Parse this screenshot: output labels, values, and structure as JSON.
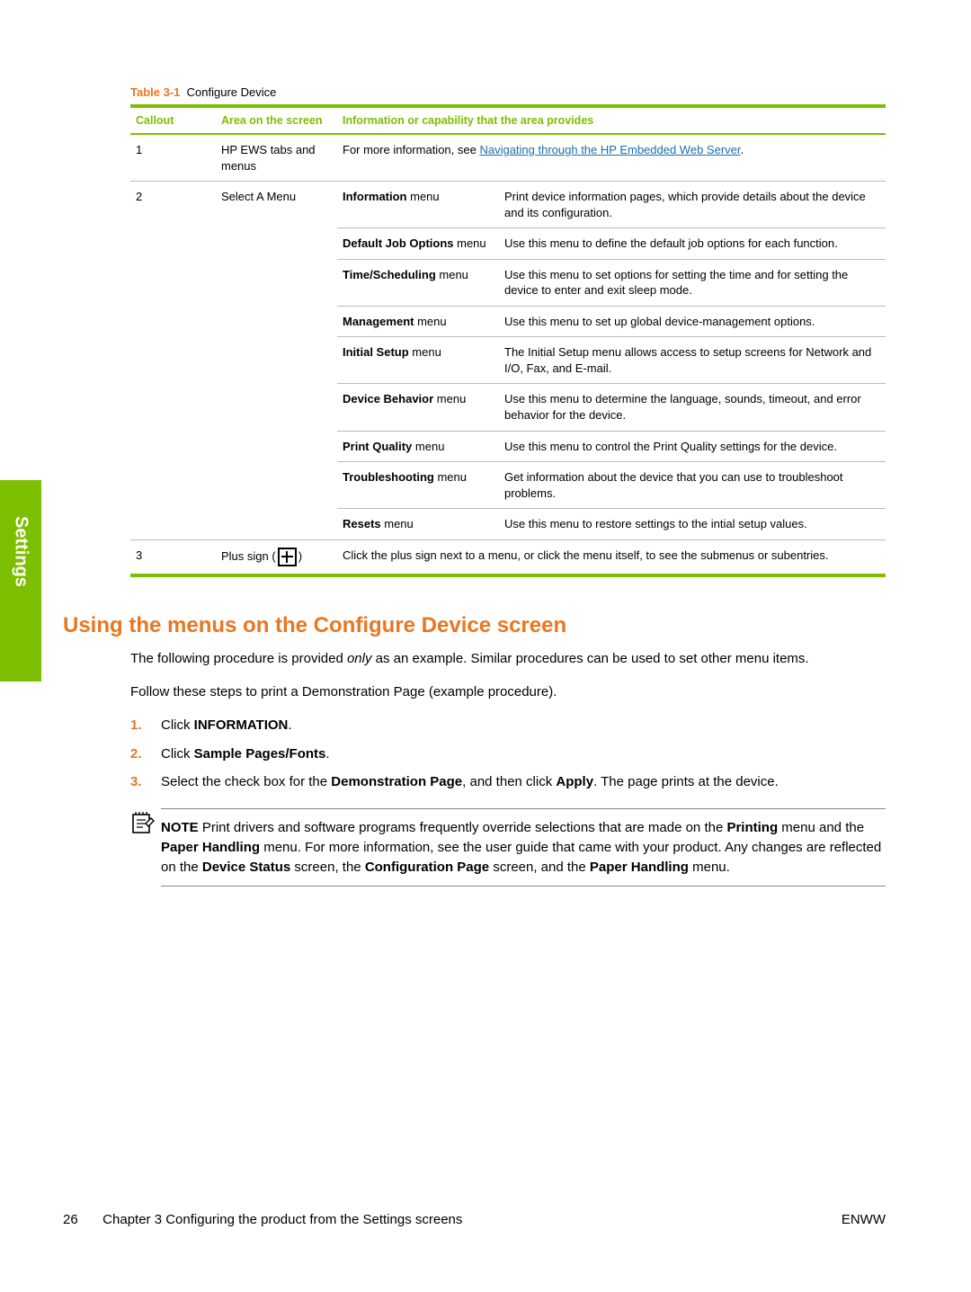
{
  "sideTab": "Settings",
  "tableCaption": {
    "label": "Table 3-1",
    "title": "Configure Device"
  },
  "tableHeaders": {
    "callout": "Callout",
    "area": "Area on the screen",
    "info": "Information or capability that the area provides"
  },
  "row1": {
    "callout": "1",
    "area": "HP EWS tabs and menus",
    "infoPrefix": "For more information, see ",
    "link": "Navigating through the HP Embedded Web Server",
    "infoSuffix": "."
  },
  "row2": {
    "callout": "2",
    "area": "Select A Menu",
    "menus": [
      {
        "name": "Information",
        "suffix": " menu",
        "desc": "Print device information pages, which provide details about the device and its configuration."
      },
      {
        "name": "Default Job Options",
        "suffix": " menu",
        "desc": "Use this menu to define the default job options for each function."
      },
      {
        "name": "Time/Scheduling",
        "suffix": " menu",
        "desc": "Use this menu to set options for setting the time and for setting the device to enter and exit sleep mode."
      },
      {
        "name": "Management",
        "suffix": " menu",
        "desc": "Use this menu to set up global device-management options."
      },
      {
        "name": "Initial Setup",
        "suffix": " menu",
        "desc": "The Initial Setup menu allows access to setup screens for Network and I/O, Fax, and E-mail."
      },
      {
        "name": "Device Behavior",
        "suffix": " menu",
        "desc": "Use this menu to determine the language, sounds, timeout, and error behavior for the device."
      },
      {
        "name": "Print Quality",
        "suffix": " menu",
        "desc": "Use this menu to control the Print Quality settings for the device."
      },
      {
        "name": "Troubleshooting",
        "suffix": " menu",
        "desc": "Get information about the device that you can use to troubleshoot problems."
      },
      {
        "name": "Resets",
        "suffix": " menu",
        "desc": "Use this menu to restore settings to the intial setup values."
      }
    ]
  },
  "row3": {
    "callout": "3",
    "areaPrefix": "Plus sign (",
    "areaSuffix": ")",
    "info": "Click the plus sign next to a menu, or click the menu itself, to see the submenus or subentries."
  },
  "sectionHeading": "Using the menus on the Configure Device screen",
  "para1a": "The following procedure is provided ",
  "para1em": "only",
  "para1b": " as an example. Similar procedures can be used to set other menu items.",
  "para2": "Follow these steps to print a Demonstration Page (example procedure).",
  "steps": {
    "s1": {
      "num": "1.",
      "pre": "Click ",
      "b": "INFORMATION",
      "post": "."
    },
    "s2": {
      "num": "2.",
      "pre": "Click ",
      "b": "Sample Pages/Fonts",
      "post": "."
    },
    "s3": {
      "num": "3.",
      "pre": "Select the check box for the ",
      "b1": "Demonstration Page",
      "mid": ", and then click ",
      "b2": "Apply",
      "post": ". The page prints at the device."
    }
  },
  "note": {
    "label": "NOTE",
    "t1": "   Print drivers and software programs frequently override selections that are made on the ",
    "b1": "Printing",
    "t2": " menu and the ",
    "b2": "Paper Handling",
    "t3": " menu. For more information, see the user guide that came with your product. Any changes are reflected on the ",
    "b3": "Device Status",
    "t4": " screen, the ",
    "b4": "Configuration Page",
    "t5": " screen, and the ",
    "b5": "Paper Handling",
    "t6": " menu."
  },
  "footer": {
    "pageNum": "26",
    "chapter": "Chapter 3   Configuring the product from the Settings screens",
    "right": "ENWW"
  }
}
